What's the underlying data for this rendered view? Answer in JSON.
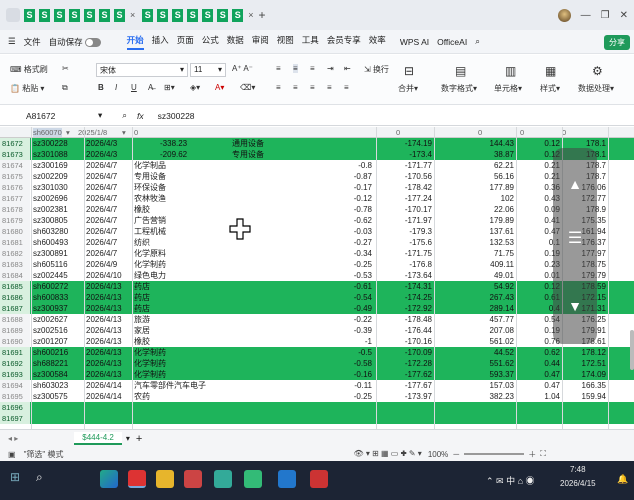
{
  "window": {
    "tab_count": 14,
    "tab_icon_glyph": "S",
    "close_glyph": "×"
  },
  "menu": {
    "file": "文件",
    "autosave": "自动保存",
    "items": [
      "开始",
      "插入",
      "页面",
      "公式",
      "数据",
      "审阅",
      "视图",
      "工具",
      "会员专享",
      "效率"
    ],
    "active": "开始",
    "wps_ai": "WPS AI",
    "officeai": "OfficeAI",
    "share": "分享"
  },
  "ribbon": {
    "format_painter": "格式刷",
    "paste": "粘贴",
    "font_name": "宋体",
    "font_size": "11",
    "wrap": "换行",
    "merge": "合并",
    "number_format": "数字格式",
    "cell": "单元格",
    "style": "样式",
    "data_process": "数据处理"
  },
  "formula_bar": {
    "name_box": "A81672",
    "fx": "fx",
    "value": "sz300228"
  },
  "header": {
    "col_a": "sh60070",
    "col_b": "2025/1/8",
    "col_c": "0",
    "col_e": "0",
    "col_f": "0",
    "col_g": "0",
    "col_h": "0"
  },
  "rows": [
    {
      "n": "81672",
      "code": "sz300228",
      "date": "2026/4/3",
      "name": "",
      "chg": "-338.23",
      "v1": "通用设备",
      "v2": "-174.19",
      "v3": "144.43",
      "v4": "0.12",
      "v5": "178.1",
      "green": true,
      "shift": true
    },
    {
      "n": "81673",
      "code": "sz301088",
      "date": "2026/4/3",
      "name": "",
      "chg": "-209.62",
      "v1": "专用设备",
      "v2": "-173.4",
      "v3": "38.87",
      "v4": "0.12",
      "v5": "178.1",
      "green": true,
      "shift": true
    },
    {
      "n": "81674",
      "code": "sz300169",
      "date": "2026/4/7",
      "name": "化学制品",
      "chg": "-0.8",
      "v2": "-171.77",
      "v3": "62.21",
      "v4": "0.21",
      "v5": "178.7"
    },
    {
      "n": "81675",
      "code": "sz002209",
      "date": "2026/4/7",
      "name": "专用设备",
      "chg": "-0.87",
      "v2": "-170.56",
      "v3": "56.16",
      "v4": "0.21",
      "v5": "178.7"
    },
    {
      "n": "81676",
      "code": "sz301030",
      "date": "2026/4/7",
      "name": "环保设备",
      "chg": "-0.17",
      "v2": "-178.42",
      "v3": "177.89",
      "v4": "0.36",
      "v5": "176.06"
    },
    {
      "n": "81677",
      "code": "sz002696",
      "date": "2026/4/7",
      "name": "农林牧渔",
      "chg": "-0.12",
      "v2": "-177.24",
      "v3": "102",
      "v4": "0.43",
      "v5": "172.77"
    },
    {
      "n": "81678",
      "code": "sz002381",
      "date": "2026/4/7",
      "name": "橡胶",
      "chg": "-0.78",
      "v2": "-170.17",
      "v3": "22.06",
      "v4": "0.09",
      "v5": "178.9"
    },
    {
      "n": "81679",
      "code": "sz300805",
      "date": "2026/4/7",
      "name": "广告营销",
      "chg": "-0.62",
      "v2": "-171.97",
      "v3": "179.89",
      "v4": "0.41",
      "v5": "175.35"
    },
    {
      "n": "81680",
      "code": "sh603280",
      "date": "2026/4/7",
      "name": "工程机械",
      "chg": "-0.03",
      "v2": "-179.3",
      "v3": "137.61",
      "v4": "0.47",
      "v5": "161.94"
    },
    {
      "n": "81681",
      "code": "sh600493",
      "date": "2026/4/7",
      "name": "纺织",
      "chg": "-0.27",
      "v2": "-175.6",
      "v3": "132.53",
      "v4": "0.1",
      "v5": "176.37"
    },
    {
      "n": "81682",
      "code": "sz300891",
      "date": "2026/4/7",
      "name": "化学原料",
      "chg": "-0.34",
      "v2": "-171.75",
      "v3": "71.75",
      "v4": "0.19",
      "v5": "177.97"
    },
    {
      "n": "81683",
      "code": "sh605116",
      "date": "2026/4/9",
      "name": "化学制药",
      "chg": "-0.25",
      "v2": "-176.8",
      "v3": "409.11",
      "v4": "0.23",
      "v5": "178.75"
    },
    {
      "n": "81684",
      "code": "sz002445",
      "date": "2026/4/10",
      "name": "绿色电力",
      "chg": "-0.53",
      "v2": "-173.64",
      "v3": "49.01",
      "v4": "0.01",
      "v5": "179.79"
    },
    {
      "n": "81685",
      "code": "sh600272",
      "date": "2026/4/13",
      "name": "药店",
      "chg": "-0.61",
      "v2": "-174.31",
      "v3": "54.92",
      "v4": "0.12",
      "v5": "178.59",
      "green": true
    },
    {
      "n": "81686",
      "code": "sh600833",
      "date": "2026/4/13",
      "name": "药店",
      "chg": "-0.54",
      "v2": "-174.25",
      "v3": "267.43",
      "v4": "0.61",
      "v5": "172.15",
      "green": true
    },
    {
      "n": "81687",
      "code": "sz300937",
      "date": "2026/4/13",
      "name": "药店",
      "chg": "-0.49",
      "v2": "-172.92",
      "v3": "289.14",
      "v4": "0.4",
      "v5": "171.31",
      "green": true
    },
    {
      "n": "81688",
      "code": "sz002627",
      "date": "2026/4/13",
      "name": "旅游",
      "chg": "-0.22",
      "v2": "-178.48",
      "v3": "457.77",
      "v4": "0.54",
      "v5": "176.25"
    },
    {
      "n": "81689",
      "code": "sz002516",
      "date": "2026/4/13",
      "name": "家居",
      "chg": "-0.39",
      "v2": "-176.44",
      "v3": "207.08",
      "v4": "0.19",
      "v5": "179.91"
    },
    {
      "n": "81690",
      "code": "sz001207",
      "date": "2026/4/13",
      "name": "橡胶",
      "chg": "-1",
      "v2": "-170.16",
      "v3": "561.02",
      "v4": "0.76",
      "v5": "178.61"
    },
    {
      "n": "81691",
      "code": "sh600216",
      "date": "2026/4/13",
      "name": "化学制药",
      "chg": "-0.5",
      "v2": "-170.09",
      "v3": "44.52",
      "v4": "0.62",
      "v5": "178.12",
      "green": true
    },
    {
      "n": "81692",
      "code": "sh688221",
      "date": "2026/4/13",
      "name": "化学制药",
      "chg": "-0.58",
      "v2": "-172.28",
      "v3": "551.62",
      "v4": "0.44",
      "v5": "172.51",
      "green": true
    },
    {
      "n": "81693",
      "code": "sz300584",
      "date": "2026/4/13",
      "name": "化学制药",
      "chg": "-0.16",
      "v2": "-177.62",
      "v3": "593.37",
      "v4": "0.47",
      "v5": "174.09",
      "green": true
    },
    {
      "n": "81694",
      "code": "sh603023",
      "date": "2026/4/14",
      "name": "汽车零部件汽车电子",
      "chg": "-0.11",
      "v2": "-177.67",
      "v3": "157.03",
      "v4": "0.47",
      "v5": "166.35"
    },
    {
      "n": "81695",
      "code": "sz300575",
      "date": "2026/4/14",
      "name": "农药",
      "chg": "-0.25",
      "v2": "-173.97",
      "v3": "382.23",
      "v4": "1.04",
      "v5": "159.94"
    },
    {
      "n": "81696",
      "green_blank": true
    },
    {
      "n": "81697",
      "green_blank": true
    }
  ],
  "sheet": {
    "name": "$444-4.2"
  },
  "status": {
    "mode": "\"筛选\" 模式",
    "zoom": "100%"
  },
  "clock": {
    "time": "7:48",
    "date": "2026/4/15"
  }
}
